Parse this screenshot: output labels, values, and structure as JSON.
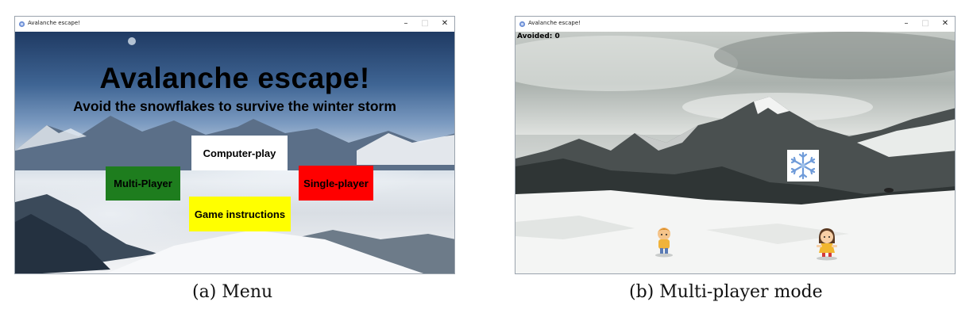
{
  "windows": [
    {
      "title": "Avalanche escape!",
      "controls": {
        "minimize": "–",
        "maximize": "□",
        "close": "✕"
      }
    },
    {
      "title": "Avalanche escape!",
      "controls": {
        "minimize": "–",
        "maximize": "□",
        "close": "✕"
      }
    }
  ],
  "menu": {
    "title": "Avalanche escape!",
    "subtitle": "Avoid the snowflakes to survive the winter storm",
    "buttons": {
      "computer_play": {
        "label": "Computer-play",
        "color": "#ffffff"
      },
      "multi_player": {
        "label": "Multi-Player",
        "color": "#1e7d1e"
      },
      "single_player": {
        "label": "Single-player",
        "color": "#ff0000"
      },
      "instructions": {
        "label": "Game instructions",
        "color": "#ffff00"
      }
    }
  },
  "multiplayer": {
    "score_text": "Avoided: 0",
    "obstacle_icon": "snowflake-icon",
    "players": [
      "boy-character",
      "girl-character"
    ]
  },
  "captions": {
    "a": "(a) Menu",
    "b": "(b) Multi-player mode"
  }
}
